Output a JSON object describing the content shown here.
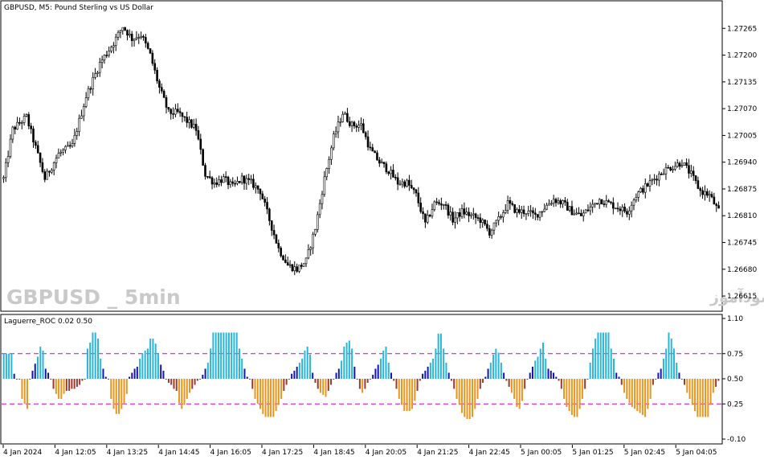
{
  "chart_title": "GBPUSD, M5:  Pound Sterling vs US Dollar",
  "watermark_symbol": "GBPUSD _ 5min",
  "watermark_site": "انتشار در سایت سودآموز",
  "chart_data": [
    {
      "type": "candlestick",
      "symbol": "GBPUSD",
      "timeframe": "M5",
      "title": "GBPUSD, M5:  Pound Sterling vs US Dollar",
      "ylim": [
        1.2658,
        1.2733
      ],
      "y_ticks": [
        "1.27265",
        "1.27200",
        "1.27135",
        "1.27070",
        "1.27005",
        "1.26940",
        "1.26875",
        "1.26810",
        "1.26745",
        "1.26680",
        "1.26615"
      ],
      "x_ticks": [
        "4 Jan 2024",
        "4 Jan 12:05",
        "4 Jan 13:25",
        "4 Jan 14:45",
        "4 Jan 16:05",
        "4 Jan 17:25",
        "4 Jan 18:45",
        "4 Jan 20:05",
        "4 Jan 21:25",
        "4 Jan 22:45",
        "5 Jan 00:05",
        "5 Jan 01:25",
        "5 Jan 02:45",
        "5 Jan 04:05"
      ],
      "close_path": [
        [
          0,
          1.269
        ],
        [
          4,
          1.2702
        ],
        [
          10,
          1.2705
        ],
        [
          18,
          1.269
        ],
        [
          24,
          1.2696
        ],
        [
          30,
          1.2698
        ],
        [
          36,
          1.271
        ],
        [
          42,
          1.2718
        ],
        [
          48,
          1.2723
        ],
        [
          52,
          1.2727
        ],
        [
          56,
          1.2724
        ],
        [
          60,
          1.2725
        ],
        [
          64,
          1.272
        ],
        [
          68,
          1.2712
        ],
        [
          72,
          1.2706
        ],
        [
          76,
          1.2706
        ],
        [
          80,
          1.2704
        ],
        [
          84,
          1.2702
        ],
        [
          88,
          1.2691
        ],
        [
          92,
          1.2689
        ],
        [
          96,
          1.269
        ],
        [
          100,
          1.2688
        ],
        [
          104,
          1.269
        ],
        [
          108,
          1.2689
        ],
        [
          112,
          1.2687
        ],
        [
          116,
          1.268
        ],
        [
          120,
          1.2673
        ],
        [
          124,
          1.2669
        ],
        [
          128,
          1.2668
        ],
        [
          132,
          1.267
        ],
        [
          136,
          1.2678
        ],
        [
          140,
          1.269
        ],
        [
          144,
          1.27
        ],
        [
          148,
          1.2706
        ],
        [
          152,
          1.2703
        ],
        [
          156,
          1.2703
        ],
        [
          160,
          1.2697
        ],
        [
          164,
          1.2694
        ],
        [
          168,
          1.2692
        ],
        [
          172,
          1.2689
        ],
        [
          176,
          1.2689
        ],
        [
          180,
          1.2686
        ],
        [
          184,
          1.2679
        ],
        [
          188,
          1.2684
        ],
        [
          192,
          1.2684
        ],
        [
          196,
          1.268
        ],
        [
          200,
          1.2682
        ],
        [
          204,
          1.2681
        ],
        [
          208,
          1.268
        ],
        [
          212,
          1.2677
        ],
        [
          216,
          1.268
        ],
        [
          220,
          1.2684
        ],
        [
          224,
          1.2682
        ],
        [
          228,
          1.2682
        ],
        [
          232,
          1.2681
        ],
        [
          236,
          1.2683
        ],
        [
          240,
          1.2685
        ],
        [
          244,
          1.2684
        ],
        [
          248,
          1.2682
        ],
        [
          252,
          1.2681
        ],
        [
          256,
          1.2683
        ],
        [
          260,
          1.2685
        ],
        [
          264,
          1.2684
        ],
        [
          268,
          1.2683
        ],
        [
          272,
          1.2682
        ],
        [
          276,
          1.2686
        ],
        [
          280,
          1.2688
        ],
        [
          284,
          1.269
        ],
        [
          288,
          1.2692
        ],
        [
          292,
          1.2693
        ],
        [
          296,
          1.2694
        ],
        [
          300,
          1.2691
        ],
        [
          304,
          1.2687
        ],
        [
          308,
          1.2686
        ],
        [
          312,
          1.2682
        ]
      ]
    },
    {
      "type": "bar",
      "indicator": "Laguerre_ROC",
      "params": [
        0.02,
        0.5
      ],
      "title": "Laguerre_ROC 0.02 0.50",
      "ylim": [
        -0.1,
        1.1
      ],
      "y_ticks": [
        "1.10",
        "0.75",
        "0.50",
        "0.25",
        "-0.10"
      ],
      "levels": [
        0.75,
        0.25
      ],
      "baseline": 0.5,
      "colors": {
        "strong_up": "#29b6d8",
        "weak_up": "#1414b4",
        "weak_down": "#a0382c",
        "strong_down": "#e8961e",
        "level_line": "#d000d0"
      },
      "values": [
        0.75,
        0.75,
        0.75,
        0.75,
        0.55,
        0.5,
        0.5,
        0.3,
        0.25,
        0.2,
        0.5,
        0.58,
        0.65,
        0.72,
        0.82,
        0.78,
        0.6,
        0.56,
        0.5,
        0.4,
        0.35,
        0.3,
        0.3,
        0.35,
        0.38,
        0.38,
        0.4,
        0.4,
        0.42,
        0.44,
        0.48,
        0.5,
        0.8,
        0.86,
        0.96,
        0.96,
        0.9,
        0.7,
        0.6,
        0.52,
        0.5,
        0.3,
        0.2,
        0.15,
        0.15,
        0.2,
        0.25,
        0.35,
        0.52,
        0.56,
        0.6,
        0.62,
        0.7,
        0.75,
        0.78,
        0.8,
        0.9,
        0.9,
        0.85,
        0.75,
        0.64,
        0.58,
        0.5,
        0.46,
        0.44,
        0.4,
        0.38,
        0.26,
        0.2,
        0.24,
        0.3,
        0.36,
        0.4,
        0.44,
        0.48,
        0.5,
        0.54,
        0.6,
        0.66,
        0.8,
        0.96,
        0.96,
        0.96,
        0.96,
        0.96,
        0.96,
        0.96,
        0.96,
        0.96,
        0.96,
        0.8,
        0.7,
        0.6,
        0.52,
        0.5,
        0.4,
        0.3,
        0.25,
        0.2,
        0.15,
        0.12,
        0.12,
        0.12,
        0.12,
        0.18,
        0.24,
        0.3,
        0.38,
        0.44,
        0.5,
        0.55,
        0.58,
        0.62,
        0.66,
        0.7,
        0.78,
        0.82,
        0.74,
        0.56,
        0.46,
        0.4,
        0.36,
        0.34,
        0.32,
        0.38,
        0.44,
        0.5,
        0.56,
        0.6,
        0.68,
        0.82,
        0.86,
        0.88,
        0.8,
        0.62,
        0.5,
        0.4,
        0.36,
        0.4,
        0.46,
        0.5,
        0.54,
        0.6,
        0.64,
        0.7,
        0.78,
        0.82,
        0.66,
        0.56,
        0.48,
        0.4,
        0.3,
        0.24,
        0.18,
        0.18,
        0.18,
        0.2,
        0.28,
        0.38,
        0.48,
        0.55,
        0.58,
        0.62,
        0.66,
        0.7,
        0.8,
        0.95,
        0.95,
        0.8,
        0.66,
        0.56,
        0.48,
        0.4,
        0.3,
        0.24,
        0.16,
        0.12,
        0.1,
        0.1,
        0.12,
        0.2,
        0.3,
        0.4,
        0.46,
        0.52,
        0.6,
        0.66,
        0.74,
        0.8,
        0.76,
        0.66,
        0.56,
        0.48,
        0.42,
        0.36,
        0.3,
        0.22,
        0.2,
        0.28,
        0.4,
        0.5,
        0.56,
        0.62,
        0.68,
        0.72,
        0.8,
        0.86,
        0.7,
        0.6,
        0.58,
        0.56,
        0.52,
        0.48,
        0.4,
        0.3,
        0.22,
        0.18,
        0.14,
        0.12,
        0.12,
        0.2,
        0.3,
        0.4,
        0.5,
        0.66,
        0.8,
        0.9,
        0.96,
        0.96,
        0.96,
        0.96,
        0.96,
        0.8,
        0.7,
        0.56,
        0.52,
        0.44,
        0.36,
        0.3,
        0.26,
        0.22,
        0.2,
        0.18,
        0.16,
        0.14,
        0.12,
        0.2,
        0.3,
        0.44,
        0.5,
        0.56,
        0.6,
        0.7,
        0.8,
        0.96,
        0.9,
        0.8,
        0.66,
        0.56,
        0.5,
        0.44,
        0.36,
        0.3,
        0.24,
        0.18,
        0.12,
        0.12,
        0.12,
        0.12,
        0.12,
        0.24,
        0.36,
        0.42,
        0.48
      ]
    }
  ]
}
